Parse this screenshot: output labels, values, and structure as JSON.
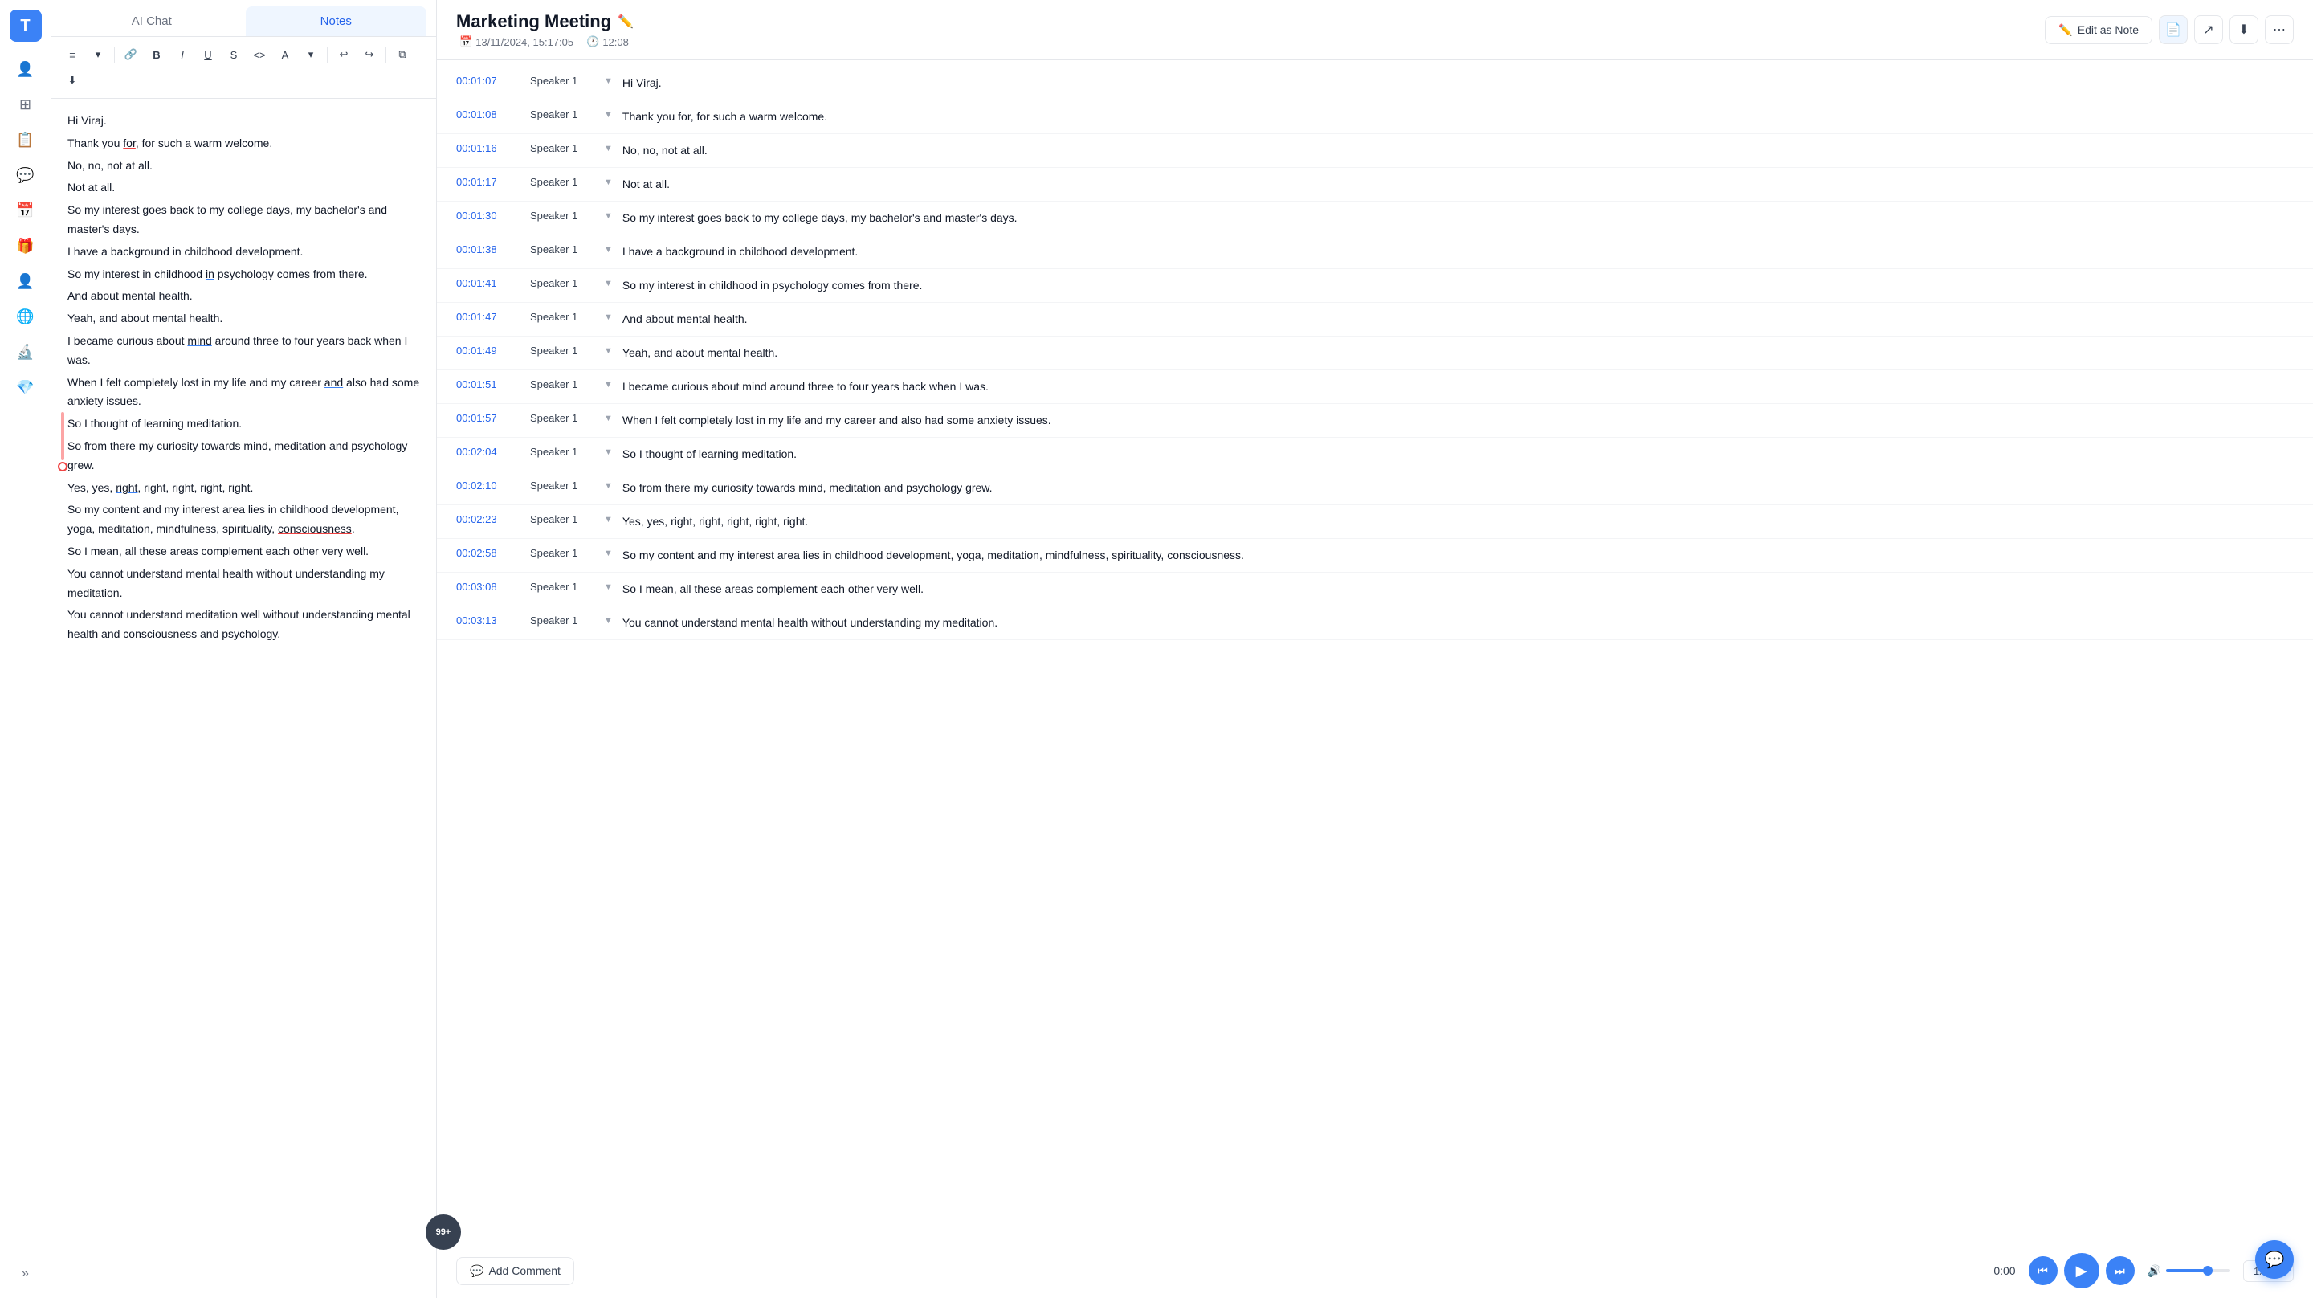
{
  "sidebar": {
    "logo": "T",
    "icons": [
      "👤",
      "⊞",
      "📋",
      "💬",
      "📅",
      "🎁",
      "👤",
      "🌐",
      "🔬",
      "💎"
    ]
  },
  "tabs": {
    "ai_chat": "AI Chat",
    "notes": "Notes",
    "active": "notes"
  },
  "toolbar": {
    "buttons": [
      "≡",
      "▾",
      "🔗",
      "B",
      "I",
      "U",
      "S",
      "<>",
      "A",
      "▾",
      "↩",
      "↪",
      "⧉",
      "⬇"
    ]
  },
  "editor": {
    "lines": [
      "Hi Viraj.",
      "Thank you for, for such a warm welcome.",
      "No, no, not at all.",
      "Not at all.",
      "So my interest goes back to my college days, my bachelor's and master's days.",
      "I have a background in childhood development.",
      "So my interest in childhood in psychology comes from there.",
      "And about mental health.",
      "Yeah, and about mental health.",
      "I became curious about mind around three to four years back when I was.",
      "When I felt completely lost in my life and my career and also had some anxiety issues.",
      "So I thought of learning meditation.",
      "So from there my curiosity towards mind, meditation and psychology grew.",
      "Yes, yes, right, right, right, right, right.",
      "So my content and my interest area lies in childhood development, yoga, meditation, mindfulness, spirituality, consciousness.",
      "So I mean, all these areas complement each other very well.",
      "You cannot understand mental health without understanding my meditation.",
      "You cannot understand meditation well without understanding mental health and consciousness and psychology."
    ]
  },
  "meeting": {
    "title": "Marketing Meeting",
    "date": "13/11/2024, 15:17:05",
    "duration": "12:08",
    "edit_as_note": "Edit as Note"
  },
  "transcript": [
    {
      "time": "00:01:07",
      "speaker": "Speaker 1",
      "text": "Hi Viraj."
    },
    {
      "time": "00:01:08",
      "speaker": "Speaker 1",
      "text": "Thank you for, for such a warm welcome."
    },
    {
      "time": "00:01:16",
      "speaker": "Speaker 1",
      "text": "No, no, not at all."
    },
    {
      "time": "00:01:17",
      "speaker": "Speaker 1",
      "text": "Not at all."
    },
    {
      "time": "00:01:30",
      "speaker": "Speaker 1",
      "text": "So my interest goes back to my college days, my bachelor's and master's days."
    },
    {
      "time": "00:01:38",
      "speaker": "Speaker 1",
      "text": "I have a background in childhood development."
    },
    {
      "time": "00:01:41",
      "speaker": "Speaker 1",
      "text": "So my interest in childhood in psychology comes from there."
    },
    {
      "time": "00:01:47",
      "speaker": "Speaker 1",
      "text": "And about mental health."
    },
    {
      "time": "00:01:49",
      "speaker": "Speaker 1",
      "text": "Yeah, and about mental health."
    },
    {
      "time": "00:01:51",
      "speaker": "Speaker 1",
      "text": "I became curious about mind around three to four years back when I was."
    },
    {
      "time": "00:01:57",
      "speaker": "Speaker 1",
      "text": "When I felt completely lost in my life and my career and also had some anxiety issues."
    },
    {
      "time": "00:02:04",
      "speaker": "Speaker 1",
      "text": "So I thought of learning meditation."
    },
    {
      "time": "00:02:10",
      "speaker": "Speaker 1",
      "text": "So from there my curiosity towards mind, meditation and psychology grew."
    },
    {
      "time": "00:02:23",
      "speaker": "Speaker 1",
      "text": "Yes, yes, right, right, right, right, right."
    },
    {
      "time": "00:02:58",
      "speaker": "Speaker 1",
      "text": "So my content and my interest area lies in childhood development, yoga, meditation, mindfulness, spirituality, consciousness."
    },
    {
      "time": "00:03:08",
      "speaker": "Speaker 1",
      "text": "So I mean, all these areas complement each other very well."
    },
    {
      "time": "00:03:13",
      "speaker": "Speaker 1",
      "text": "You cannot understand mental health without understanding my meditation."
    }
  ],
  "player": {
    "comment_label": "Add Comment",
    "current_time": "0:00",
    "speed": "1x"
  },
  "badge": {
    "count": "99+"
  }
}
